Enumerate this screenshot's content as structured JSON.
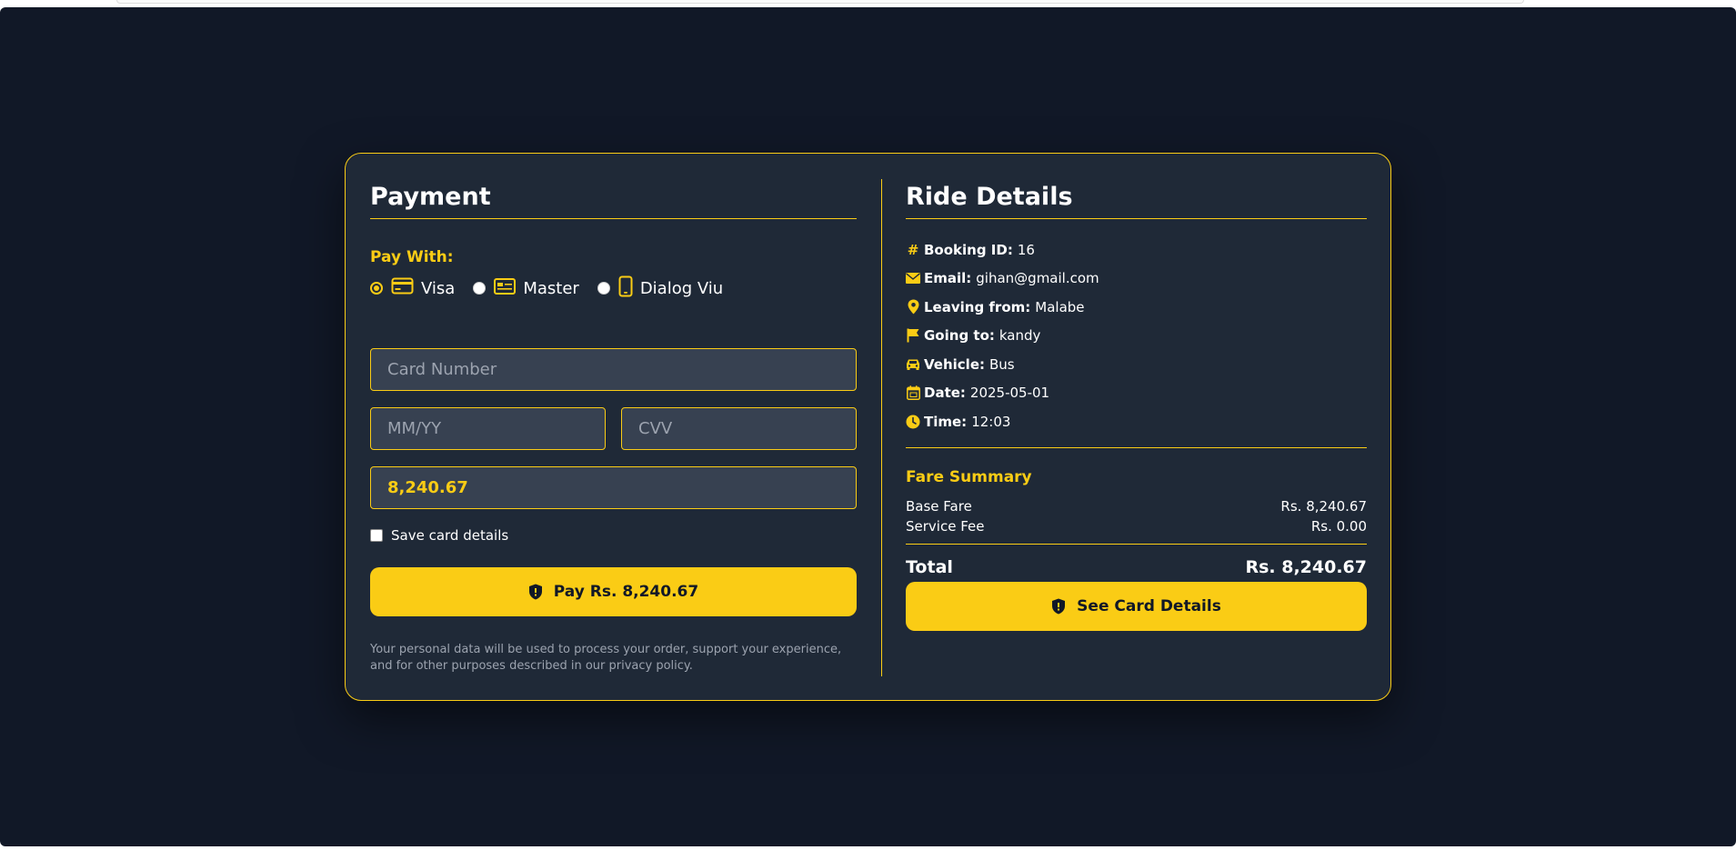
{
  "payment": {
    "title": "Payment",
    "pay_with_label": "Pay With:",
    "methods": [
      {
        "label": "Visa",
        "icon": "credit-card-icon",
        "selected": true
      },
      {
        "label": "Master",
        "icon": "card-chip-icon",
        "selected": false
      },
      {
        "label": "Dialog Viu",
        "icon": "mobile-phone-icon",
        "selected": false
      }
    ],
    "card_number_placeholder": "Card Number",
    "expiry_placeholder": "MM/YY",
    "cvv_placeholder": "CVV",
    "amount_value": "8,240.67",
    "save_card_label": "Save card details",
    "save_card_checked": false,
    "pay_button_label": "Pay Rs. 8,240.67",
    "disclaimer": "Your personal data will be used to process your order, support your experience, and for other purposes described in our privacy policy."
  },
  "ride": {
    "title": "Ride Details",
    "details": [
      {
        "icon": "hash-icon",
        "label": "Booking ID:",
        "value": "16"
      },
      {
        "icon": "envelope-icon",
        "label": "Email:",
        "value": "gihan@gmail.com"
      },
      {
        "icon": "map-pin-icon",
        "label": "Leaving from:",
        "value": "Malabe"
      },
      {
        "icon": "flag-icon",
        "label": "Going to:",
        "value": "kandy"
      },
      {
        "icon": "car-icon",
        "label": "Vehicle:",
        "value": "Bus"
      },
      {
        "icon": "calendar-icon",
        "label": "Date:",
        "value": "2025-05-01"
      },
      {
        "icon": "clock-icon",
        "label": "Time:",
        "value": "12:03"
      }
    ],
    "fare_summary_title": "Fare Summary",
    "base_fare_label": "Base Fare",
    "base_fare_value": "Rs. 8,240.67",
    "service_fee_label": "Service Fee",
    "service_fee_value": "Rs. 0.00",
    "total_label": "Total",
    "total_value": "Rs. 8,240.67",
    "see_card_button_label": "See Card Details"
  },
  "colors": {
    "accent": "#facc15",
    "background": "#111827",
    "card": "#1f2937",
    "input": "#374151"
  }
}
